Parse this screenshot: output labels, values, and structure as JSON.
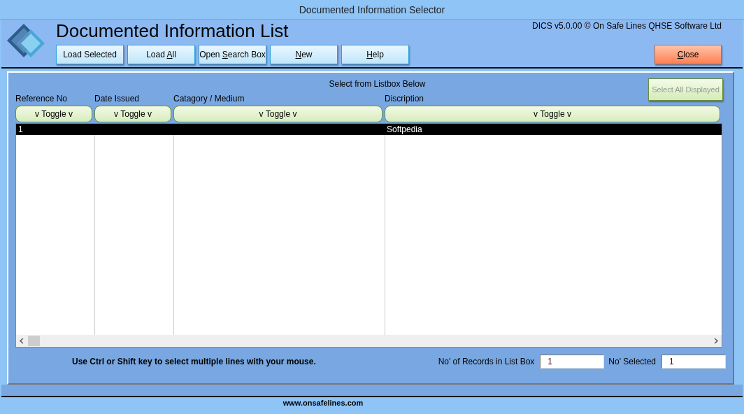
{
  "window": {
    "title": "Documented Information Selector"
  },
  "header": {
    "title": "Documented Information List",
    "copyright": "DICS v5.0.00 © On Safe Lines QHSE Software Ltd"
  },
  "toolbar": [
    {
      "parts": [
        {
          "text": "Load Selected",
          "underline": false
        }
      ]
    },
    {
      "parts": [
        {
          "text": "Load ",
          "underline": false
        },
        {
          "text": "A",
          "underline": true
        },
        {
          "text": "ll",
          "underline": false
        }
      ]
    },
    {
      "parts": [
        {
          "text": "Open ",
          "underline": false
        },
        {
          "text": "S",
          "underline": true
        },
        {
          "text": "earch Box",
          "underline": false
        }
      ]
    },
    {
      "parts": [
        {
          "text": "N",
          "underline": true
        },
        {
          "text": "ew",
          "underline": false
        }
      ]
    },
    {
      "parts": [
        {
          "text": "H",
          "underline": true
        },
        {
          "text": "elp",
          "underline": false
        }
      ]
    }
  ],
  "close_button": {
    "parts": [
      {
        "text": "C",
        "underline": true
      },
      {
        "text": "lose",
        "underline": false
      }
    ]
  },
  "panel": {
    "caption": "Select from Listbox Below",
    "select_all_button": {
      "label": "Select All Displayed",
      "disabled": true
    }
  },
  "table": {
    "columns": [
      {
        "heading": "Reference No",
        "toggle": "v Toggle v"
      },
      {
        "heading": "Date Issued",
        "toggle": "v Toggle v"
      },
      {
        "heading": "Catagory / Medium",
        "toggle": "v Toggle v"
      },
      {
        "heading": "Discription",
        "toggle": "v Toggle v"
      }
    ],
    "rows": [
      {
        "reference_no": "1",
        "description": "Softpedia",
        "selected": true
      }
    ]
  },
  "hint": "Use Ctrl or Shift key to select multiple lines with your mouse.",
  "counters": [
    {
      "label": "No' of Records in List Box",
      "value": "1"
    },
    {
      "label": "No' Selected",
      "value": "1"
    }
  ],
  "footer": {
    "website": "www.onsafelines.com"
  }
}
